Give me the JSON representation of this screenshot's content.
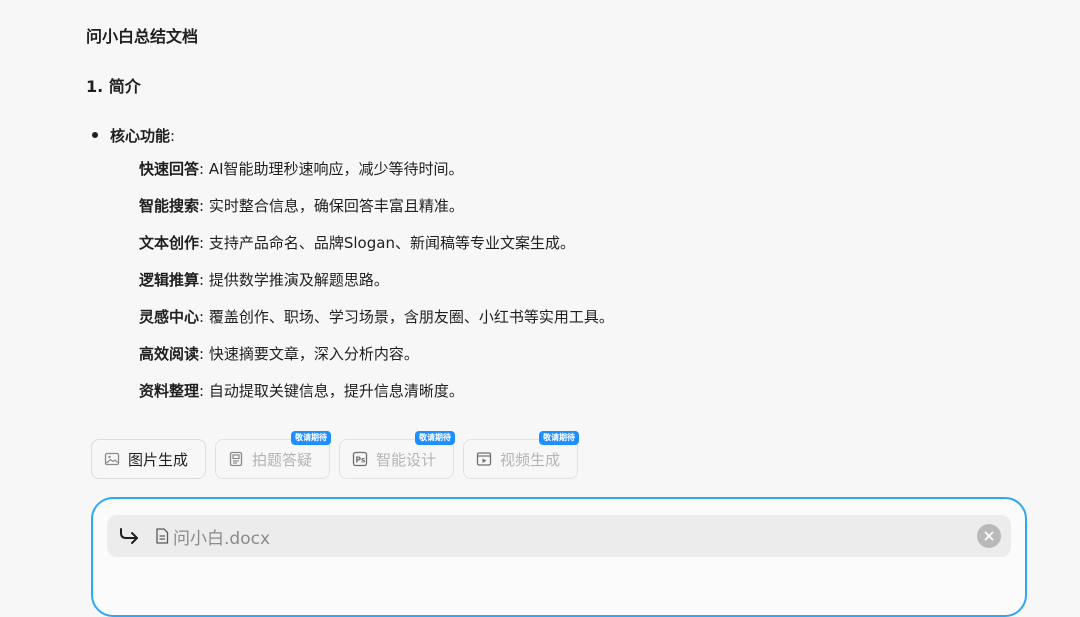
{
  "document": {
    "title": "问小白总结文档",
    "section_title": "1. 简介",
    "bullet": {
      "label": "核心功能",
      "colon": ":"
    },
    "features": [
      {
        "name": "快速回答",
        "sep": ":",
        "desc": "AI智能助理秒速响应，减少等待时间。"
      },
      {
        "name": "智能搜索",
        "sep": ":",
        "desc": "实时整合信息，确保回答丰富且精准。"
      },
      {
        "name": "文本创作",
        "sep": ":",
        "desc": "支持产品命名、品牌Slogan、新闻稿等专业文案生成。"
      },
      {
        "name": "逻辑推算",
        "sep": ":",
        "desc": "提供数学推演及解题思路。"
      },
      {
        "name": "灵感中心",
        "sep": ":",
        "desc": "覆盖创作、职场、学习场景，含朋友圈、小红书等实用工具。"
      },
      {
        "name": "高效阅读",
        "sep": ":",
        "desc": "快速摘要文章，深入分析内容。"
      },
      {
        "name": "资料整理",
        "sep": ":",
        "desc": "自动提取关键信息，提升信息清晰度。"
      }
    ]
  },
  "tools": [
    {
      "label": "图片生成",
      "icon": "image-icon",
      "enabled": true,
      "badge": ""
    },
    {
      "label": "拍题答疑",
      "icon": "scan-question-icon",
      "enabled": false,
      "badge": "敬请期待"
    },
    {
      "label": "智能设计",
      "icon": "ps-design-icon",
      "enabled": false,
      "badge": "敬请期待"
    },
    {
      "label": "视频生成",
      "icon": "video-icon",
      "enabled": false,
      "badge": "敬请期待"
    }
  ],
  "input": {
    "attachment_name": "问小白.docx",
    "reply_icon": "reply-arrow-icon",
    "file_icon": "document-icon",
    "close_icon": "close-icon"
  },
  "colors": {
    "accent": "#2fa7f5",
    "badge": "#1e8fff",
    "disabled_text": "#b4b4b4"
  }
}
